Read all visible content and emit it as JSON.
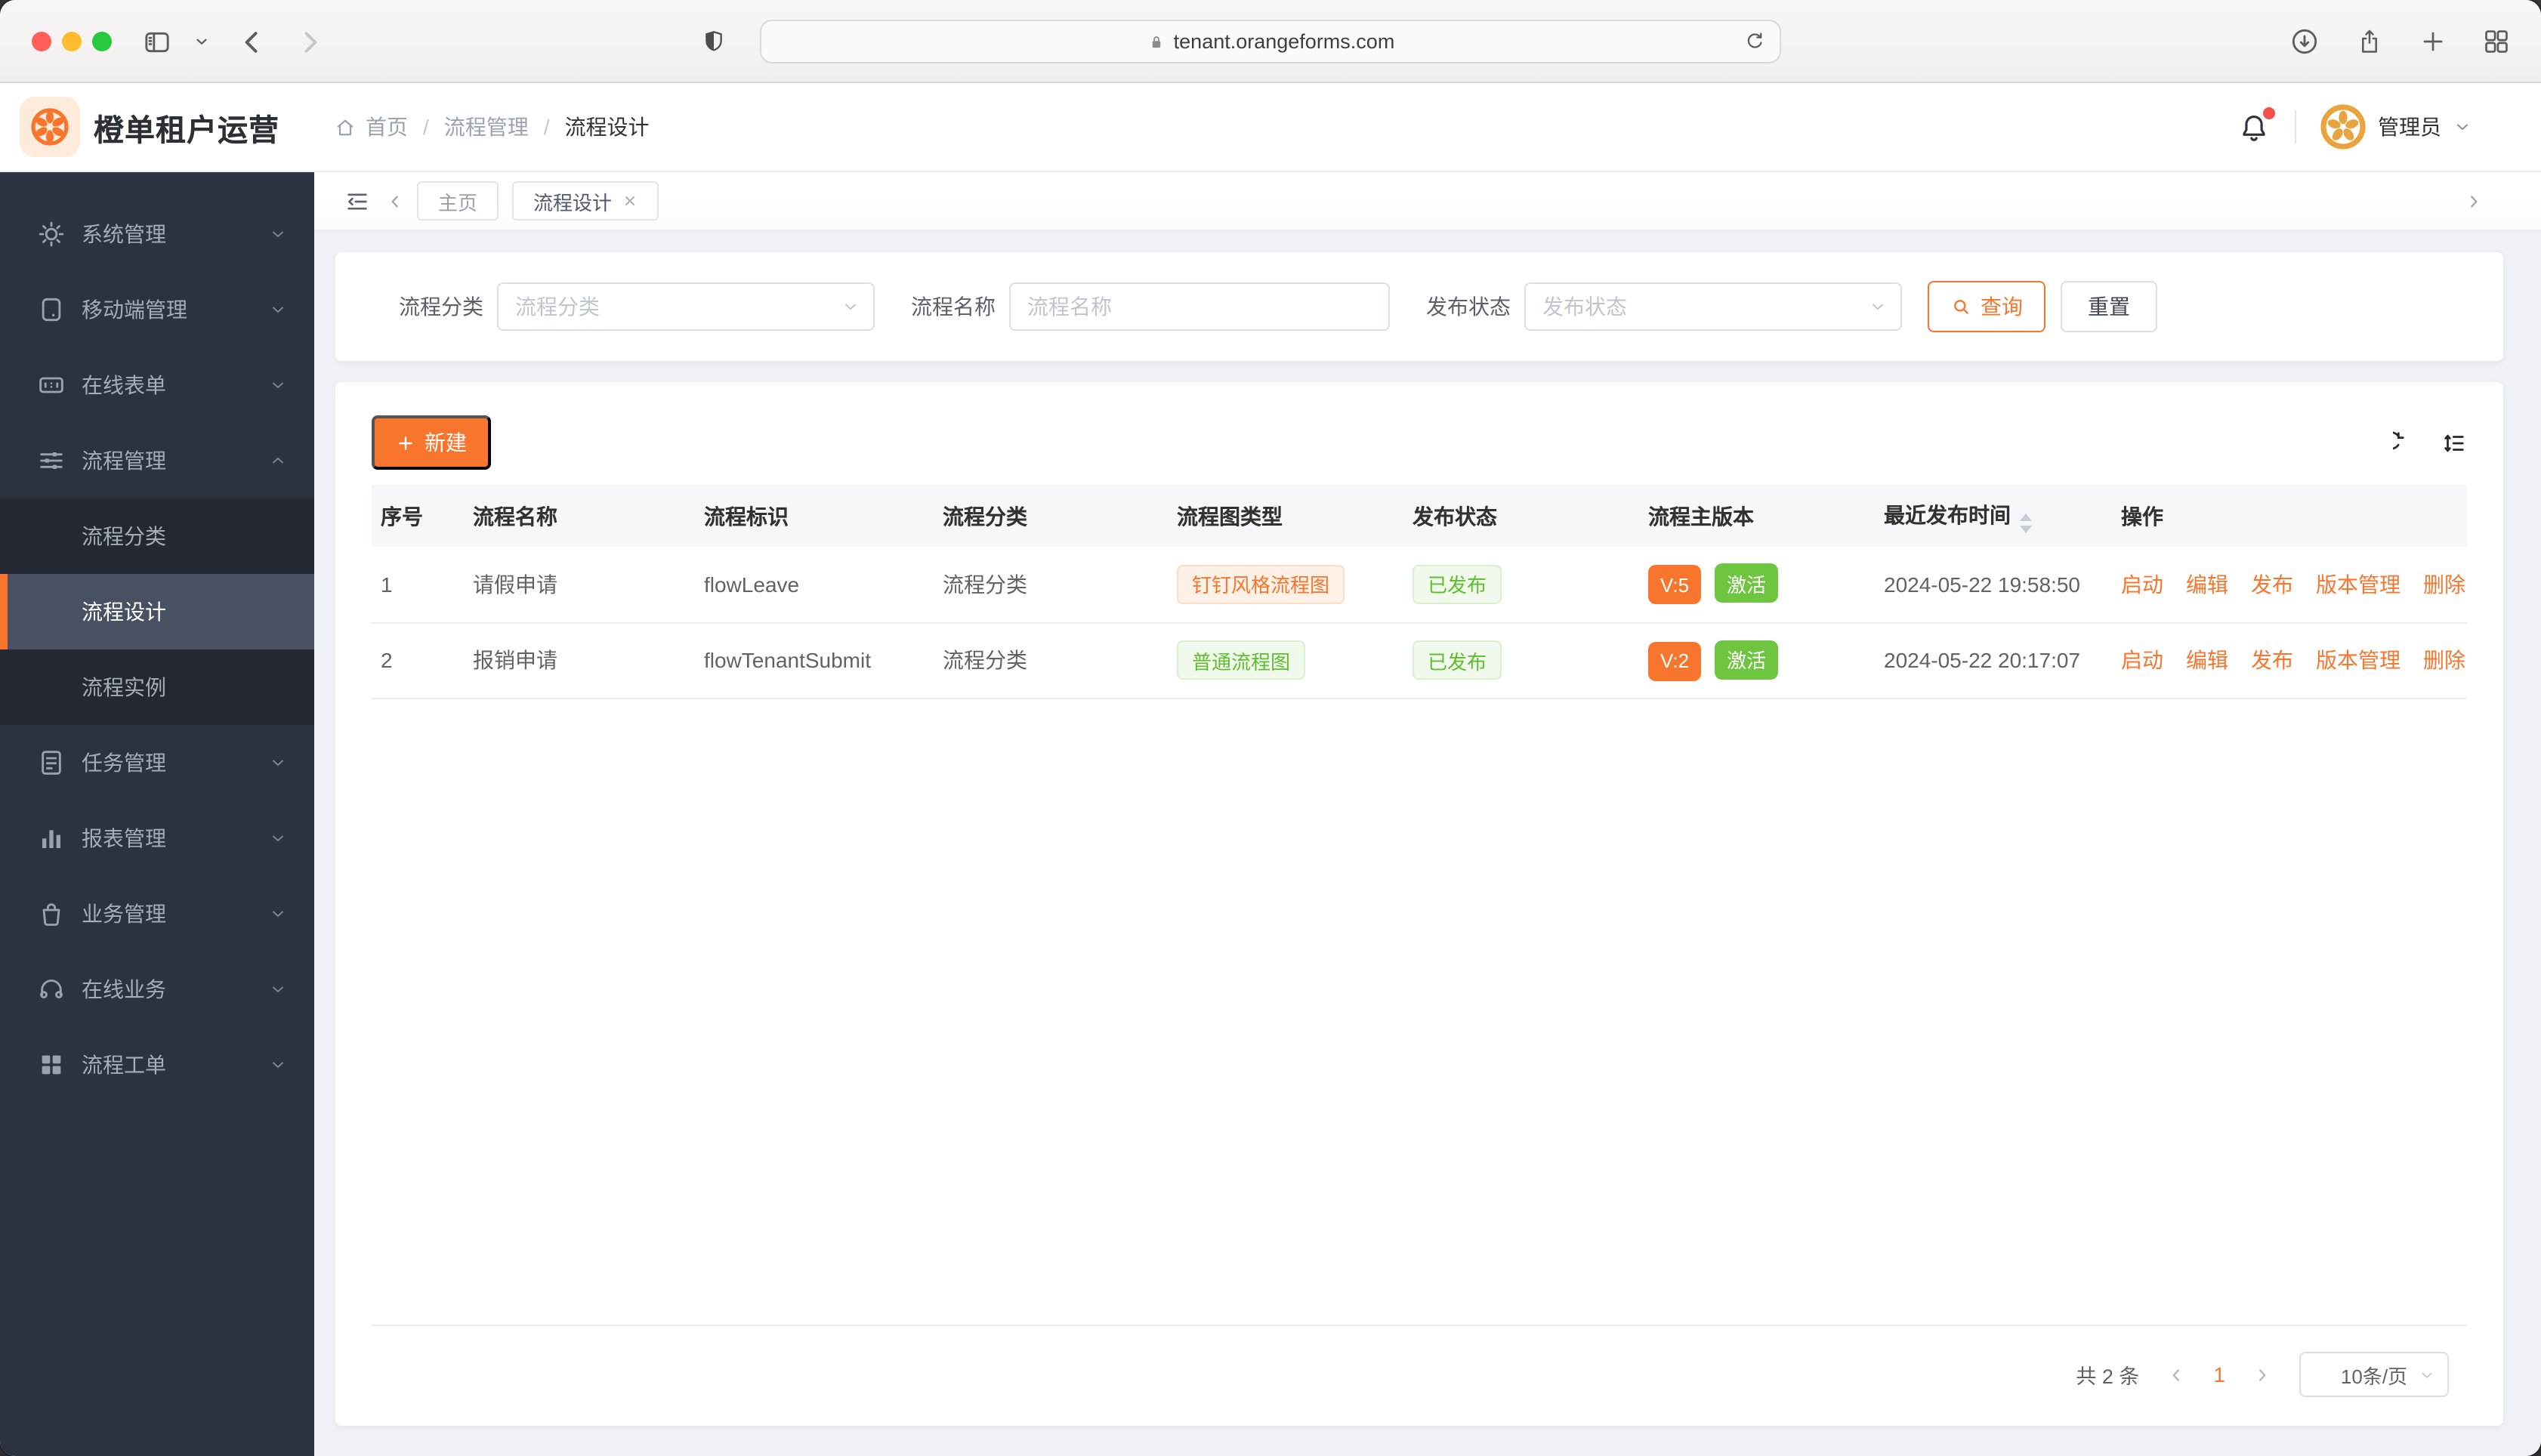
{
  "browser": {
    "url": "tenant.orangeforms.com"
  },
  "header": {
    "app_title": "橙单租户运营",
    "breadcrumb": {
      "home": "首页",
      "section": "流程管理",
      "current": "流程设计"
    },
    "user_name": "管理员"
  },
  "sidebar": {
    "system": "系统管理",
    "mobile": "移动端管理",
    "online_form": "在线表单",
    "workflow": "流程管理",
    "workflow_children": {
      "category": "流程分类",
      "design": "流程设计",
      "instance": "流程实例"
    },
    "task": "任务管理",
    "report": "报表管理",
    "business": "业务管理",
    "online_biz": "在线业务",
    "workorder": "流程工单"
  },
  "tabs": {
    "home": "主页",
    "current": "流程设计"
  },
  "filters": {
    "category_label": "流程分类",
    "category_placeholder": "流程分类",
    "name_label": "流程名称",
    "name_placeholder": "流程名称",
    "status_label": "发布状态",
    "status_placeholder": "发布状态",
    "query": "查询",
    "reset": "重置"
  },
  "toolbar": {
    "create": "新建"
  },
  "table": {
    "columns": [
      "序号",
      "流程名称",
      "流程标识",
      "流程分类",
      "流程图类型",
      "发布状态",
      "流程主版本",
      "最近发布时间",
      "操作"
    ],
    "rows": [
      {
        "no": "1",
        "name": "请假申请",
        "key": "flowLeave",
        "category": "流程分类",
        "diagram": "钉钉风格流程图",
        "diagram_color": "orange",
        "status": "已发布",
        "version": "V:5",
        "state": "激活",
        "time": "2024-05-22 19:58:50"
      },
      {
        "no": "2",
        "name": "报销申请",
        "key": "flowTenantSubmit",
        "category": "流程分类",
        "diagram": "普通流程图",
        "diagram_color": "green",
        "status": "已发布",
        "version": "V:2",
        "state": "激活",
        "time": "2024-05-22 20:17:07"
      }
    ],
    "actions": [
      "启动",
      "编辑",
      "发布",
      "版本管理",
      "删除"
    ]
  },
  "pagination": {
    "total": "共 2 条",
    "page": "1",
    "page_size": "10条/页"
  },
  "colors": {
    "accent": "#F7752C",
    "accent_bg": "#FDF1E7",
    "green_solid": "#6EC53F",
    "green_text": "#67C23A",
    "green_bg": "#F0F9EB",
    "sidebar_bg": "#2D3240",
    "content_bg": "#EEF1F5"
  }
}
